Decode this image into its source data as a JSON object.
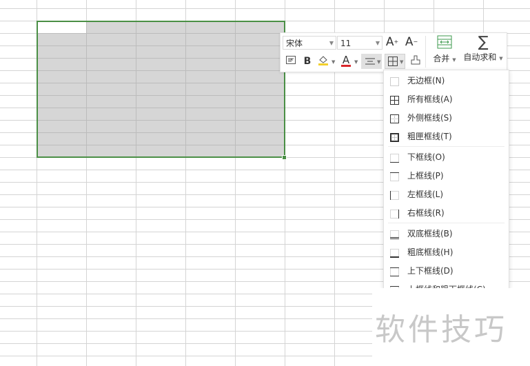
{
  "toolbar": {
    "font_name": "宋体",
    "font_size": "11",
    "increase_font": "A",
    "decrease_font": "A",
    "bold": "B",
    "font_color_label": "A",
    "merge_label": "合并",
    "autosum_symbol": "∑",
    "autosum_label": "自动求和"
  },
  "colors": {
    "selection_border": "#4a8f45",
    "font_color_bar": "#d9262a",
    "fill_color_bar": "#f2d02c",
    "merge_icon": "#3c9a4c"
  },
  "border_menu": {
    "items": [
      {
        "label": "无边框(N)",
        "icon": "no-border-icon"
      },
      {
        "label": "所有框线(A)",
        "icon": "all-borders-icon"
      },
      {
        "label": "外侧框线(S)",
        "icon": "outside-borders-icon"
      },
      {
        "label": "粗匣框线(T)",
        "icon": "thick-box-border-icon"
      },
      {
        "label": "下框线(O)",
        "icon": "bottom-border-icon"
      },
      {
        "label": "上框线(P)",
        "icon": "top-border-icon"
      },
      {
        "label": "左框线(L)",
        "icon": "left-border-icon"
      },
      {
        "label": "右框线(R)",
        "icon": "right-border-icon"
      },
      {
        "label": "双底框线(B)",
        "icon": "double-bottom-border-icon"
      },
      {
        "label": "粗底框线(H)",
        "icon": "thick-bottom-border-icon"
      },
      {
        "label": "上下框线(D)",
        "icon": "top-bottom-border-icon"
      },
      {
        "label": "上框线和粗下框线(C)",
        "icon": "top-thick-bottom-border-icon"
      }
    ]
  },
  "watermark": "软件技巧"
}
